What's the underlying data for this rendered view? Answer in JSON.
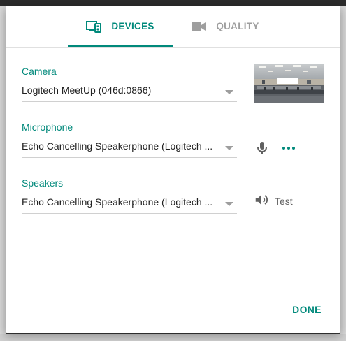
{
  "tabs": {
    "devices_label": "DEVICES",
    "quality_label": "QUALITY",
    "active": "DEVICES"
  },
  "camera": {
    "label": "Camera",
    "selected": "Logitech MeetUp (046d:0866)"
  },
  "microphone": {
    "label": "Microphone",
    "selected": "Echo Cancelling Speakerphone (Logitech ..."
  },
  "speakers": {
    "label": "Speakers",
    "selected": "Echo Cancelling Speakerphone (Logitech ...",
    "test_label": "Test"
  },
  "footer": {
    "done_label": "DONE"
  },
  "icons": {
    "devices_tab": "devices-icon",
    "quality_tab": "videocam-icon",
    "mic": "mic-icon",
    "more": "more-horiz-icon",
    "speaker": "volume-icon"
  },
  "colors": {
    "accent": "#00897b",
    "inactive": "#9e9e9e"
  }
}
